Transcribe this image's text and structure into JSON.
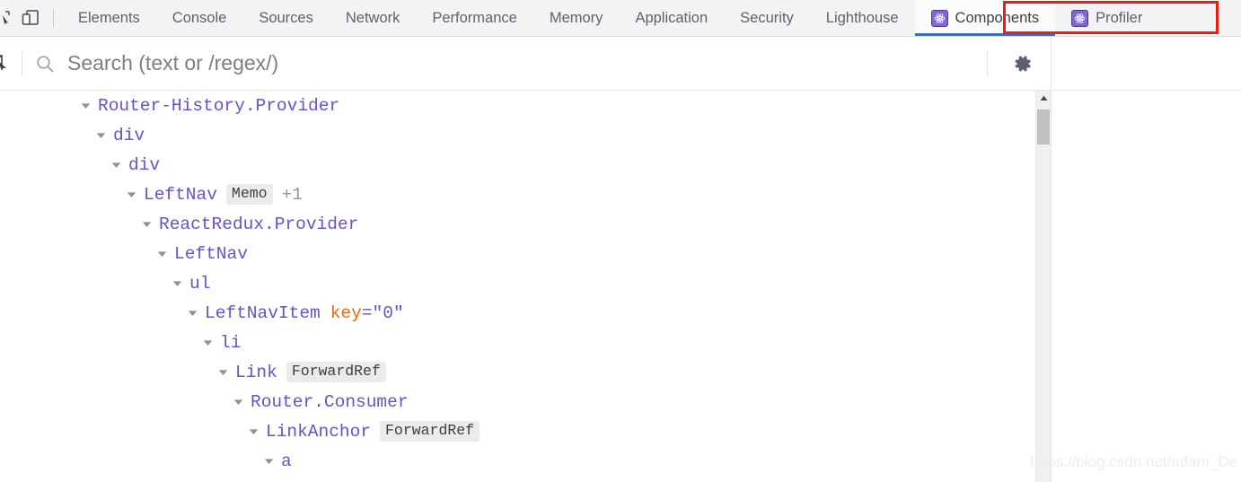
{
  "window": {
    "app": "Chrome DevTools",
    "watermark": "https://blog.csdn.net/adam_De"
  },
  "tabbar": {
    "icons": [
      {
        "name": "inspect-element-icon",
        "label": "inspect-icon"
      },
      {
        "name": "device-toolbar-icon",
        "label": "device-toolbar-icon"
      }
    ],
    "tabs": [
      {
        "label": "Elements",
        "selected": false,
        "icon": null
      },
      {
        "label": "Console",
        "selected": false,
        "icon": null
      },
      {
        "label": "Sources",
        "selected": false,
        "icon": null
      },
      {
        "label": "Network",
        "selected": false,
        "icon": null
      },
      {
        "label": "Performance",
        "selected": false,
        "icon": null
      },
      {
        "label": "Memory",
        "selected": false,
        "icon": null
      },
      {
        "label": "Application",
        "selected": false,
        "icon": null
      },
      {
        "label": "Security",
        "selected": false,
        "icon": null
      },
      {
        "label": "Lighthouse",
        "selected": false,
        "icon": null
      },
      {
        "label": "Components",
        "selected": true,
        "icon": "react-logo-icon"
      },
      {
        "label": "Profiler",
        "selected": false,
        "icon": "react-logo-icon"
      }
    ],
    "annotation": {
      "shape": "rectangle",
      "color": "#ee1c11",
      "covers": [
        "Components",
        "Profiler"
      ]
    }
  },
  "toolbar": {
    "select_element_icon": "select-element-icon",
    "search": {
      "icon": "search-icon",
      "placeholder": "Search (text or /regex/)",
      "value": ""
    },
    "settings_icon": "gear-icon"
  },
  "tree": {
    "rows": [
      {
        "depth": 0,
        "name": "Router-History.Provider",
        "badge": null,
        "extra": null,
        "attr": null,
        "expanded": true
      },
      {
        "depth": 1,
        "name": "div",
        "badge": null,
        "extra": null,
        "attr": null,
        "expanded": true
      },
      {
        "depth": 2,
        "name": "div",
        "badge": null,
        "extra": null,
        "attr": null,
        "expanded": true
      },
      {
        "depth": 3,
        "name": "LeftNav",
        "badge": "Memo",
        "extra": "+1",
        "attr": null,
        "expanded": true
      },
      {
        "depth": 4,
        "name": "ReactRedux.Provider",
        "badge": null,
        "extra": null,
        "attr": null,
        "expanded": true
      },
      {
        "depth": 5,
        "name": "LeftNav",
        "badge": null,
        "extra": null,
        "attr": null,
        "expanded": true
      },
      {
        "depth": 6,
        "name": "ul",
        "badge": null,
        "extra": null,
        "attr": null,
        "expanded": true
      },
      {
        "depth": 7,
        "name": "LeftNavItem",
        "badge": null,
        "extra": null,
        "attr": {
          "key": "key",
          "eq": "=",
          "value": "\"0\""
        },
        "expanded": true
      },
      {
        "depth": 8,
        "name": "li",
        "badge": null,
        "extra": null,
        "attr": null,
        "expanded": true
      },
      {
        "depth": 9,
        "name": "Link",
        "badge": "ForwardRef",
        "extra": null,
        "attr": null,
        "expanded": true
      },
      {
        "depth": 10,
        "name": "Router.Consumer",
        "badge": null,
        "extra": null,
        "attr": null,
        "expanded": true
      },
      {
        "depth": 11,
        "name": "LinkAnchor",
        "badge": "ForwardRef",
        "extra": null,
        "attr": null,
        "expanded": true
      },
      {
        "depth": 12,
        "name": "a",
        "badge": null,
        "extra": null,
        "attr": null,
        "expanded": true
      }
    ]
  },
  "scrollbar": {
    "name": "tree-scrollbar",
    "up_arrow_icon": "triangle-up-icon",
    "thumb_position_pct": 5
  },
  "colors": {
    "accent": "#1a73e8",
    "component_name": "#6a50c9",
    "attr_key": "#e8690b",
    "react_badge": "#8265d6",
    "annotation": "#ee1c11",
    "tabbar_bg": "#f1f3f4"
  }
}
